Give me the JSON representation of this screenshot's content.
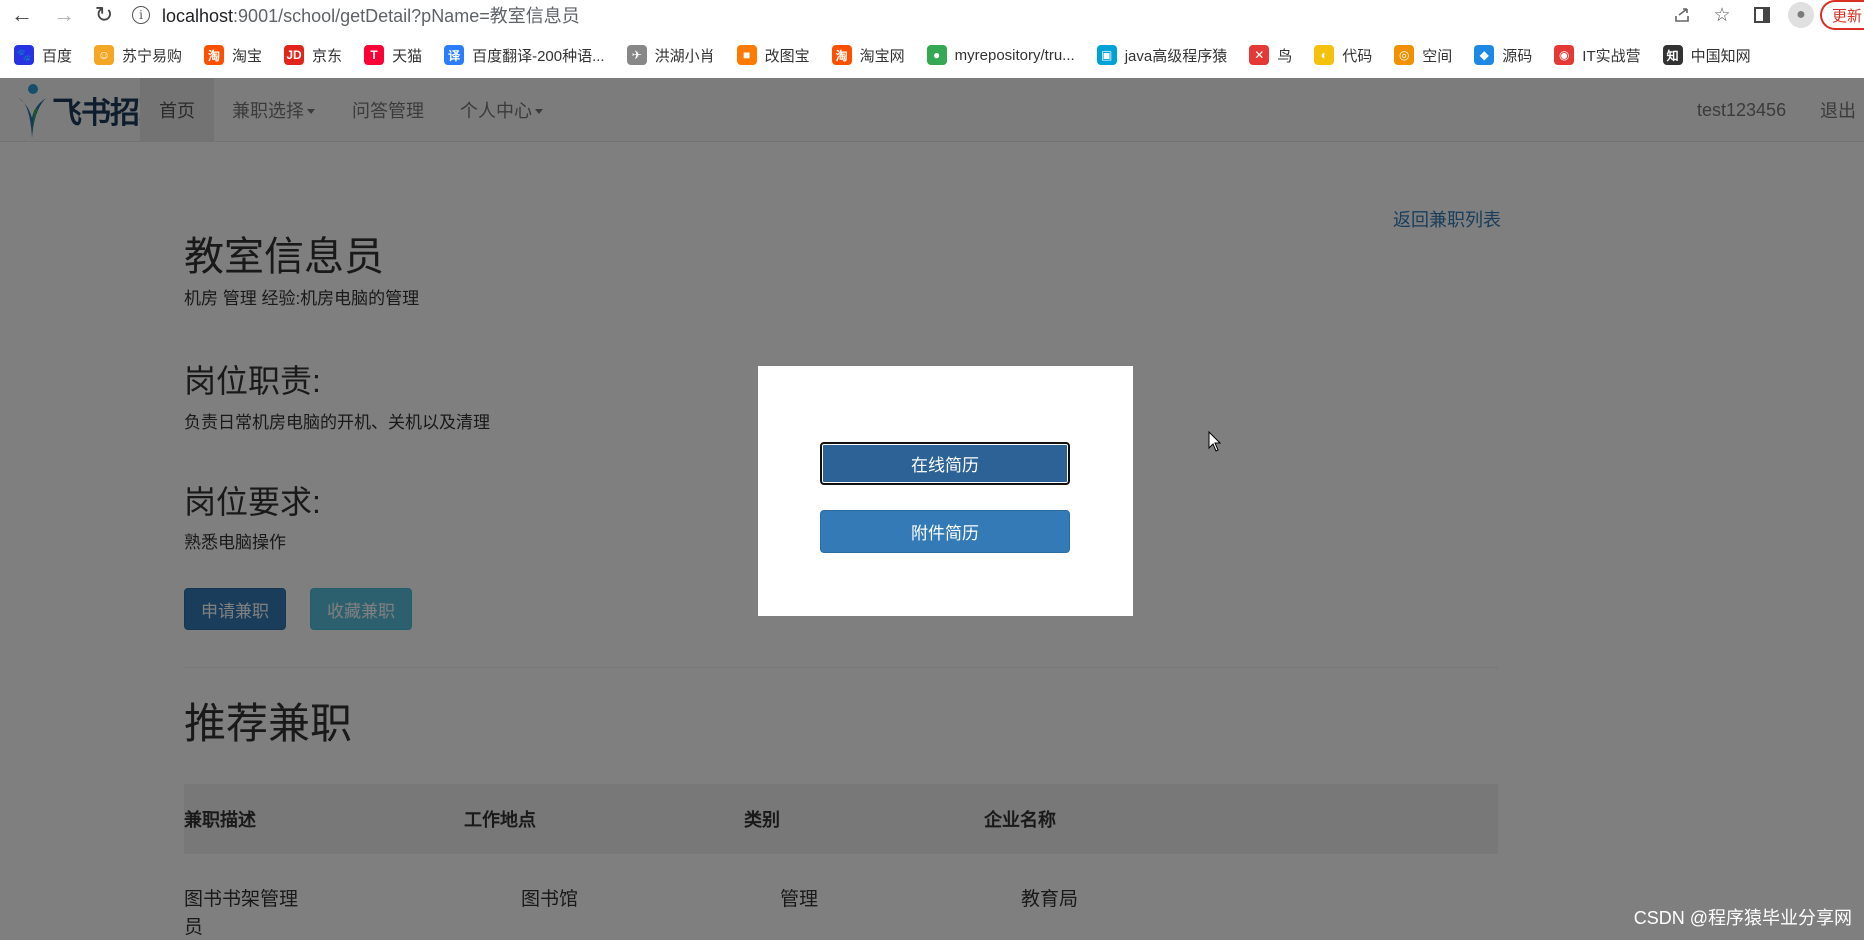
{
  "browser": {
    "url_host": "localhost",
    "url_rest": ":9001/school/getDetail?pName=教室信息员",
    "update_label": "更新",
    "bookmarks": [
      {
        "label": "百度",
        "color": "#2932e1",
        "glyph": "🐾"
      },
      {
        "label": "苏宁易购",
        "color": "#f5a623",
        "glyph": "☺"
      },
      {
        "label": "淘宝",
        "color": "#ff5000",
        "glyph": "淘"
      },
      {
        "label": "京东",
        "color": "#e1251b",
        "glyph": "JD"
      },
      {
        "label": "天猫",
        "color": "#ff0036",
        "glyph": "T"
      },
      {
        "label": "百度翻译-200种语...",
        "color": "#2b7cff",
        "glyph": "译"
      },
      {
        "label": "洪湖小肖",
        "color": "#888888",
        "glyph": "✈"
      },
      {
        "label": "改图宝",
        "color": "#ff7a00",
        "glyph": "■"
      },
      {
        "label": "淘宝网",
        "color": "#ff5000",
        "glyph": "淘"
      },
      {
        "label": "myrepository/tru...",
        "color": "#34a853",
        "glyph": "●"
      },
      {
        "label": "java高级程序猿",
        "color": "#00a1d6",
        "glyph": "▣"
      },
      {
        "label": "鸟",
        "color": "#e53935",
        "glyph": "✕"
      },
      {
        "label": "代码",
        "color": "#f4c20d",
        "glyph": "◐"
      },
      {
        "label": "空间",
        "color": "#f29100",
        "glyph": "◎"
      },
      {
        "label": "源码",
        "color": "#1e88e5",
        "glyph": "◆"
      },
      {
        "label": "IT实战营",
        "color": "#e53935",
        "glyph": "◉"
      },
      {
        "label": "中国知网",
        "color": "#333333",
        "glyph": "知"
      }
    ]
  },
  "topnav": {
    "logo_text": "飞书招聘",
    "items": [
      "首页",
      "兼职选择",
      "问答管理",
      "个人中心"
    ],
    "username": "test123456",
    "logout": "退出"
  },
  "job": {
    "back_link": "返回兼职列表",
    "title": "教室信息员",
    "meta": "机房 管理 经验:机房电脑的管理",
    "duty_heading": "岗位职责:",
    "duty_text": "负责日常机房电脑的开机、关机以及清理",
    "req_heading": "岗位要求:",
    "req_text": "熟悉电脑操作",
    "apply_button": "申请兼职",
    "favorite_button": "收藏兼职"
  },
  "recommend": {
    "title": "推荐兼职",
    "columns": [
      "兼职描述",
      "工作地点",
      "类别",
      "企业名称"
    ],
    "rows": [
      {
        "desc_line1": "图书书架管理",
        "desc_line2": "员",
        "location": "图书馆",
        "category": "管理",
        "company": "教育局"
      }
    ]
  },
  "modal": {
    "online_resume": "在线简历",
    "attachment_resume": "附件简历"
  },
  "watermark": "CSDN @程序猿毕业分享网"
}
